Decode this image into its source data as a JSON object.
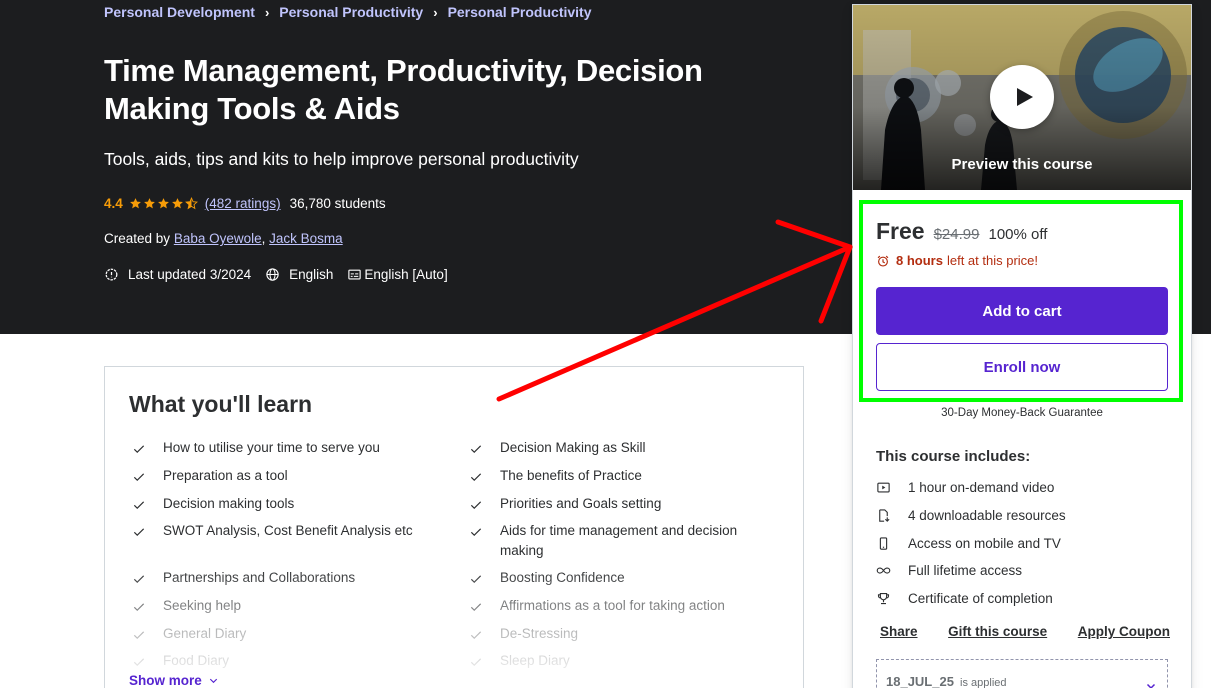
{
  "breadcrumb": [
    "Personal Development",
    "Personal Productivity",
    "Personal Productivity"
  ],
  "course": {
    "title": "Time Management, Productivity, Decision Making Tools & Aids",
    "subtitle": "Tools, aids, tips and kits to help improve personal productivity",
    "rating": "4.4",
    "rating_value": 4.4,
    "ratings_count": "(482 ratings)",
    "students": "36,780 students",
    "created_by_label": "Created by",
    "authors": [
      "Baba Oyewole",
      "Jack Bosma"
    ],
    "last_updated": "Last updated 3/2024",
    "language": "English",
    "captions": "English [Auto]"
  },
  "learn": {
    "title": "What you'll learn",
    "items": [
      "How to utilise your time to serve you",
      "Decision Making as Skill",
      "Preparation as a tool",
      "The benefits of Practice",
      "Decision making tools",
      "Priorities and Goals setting",
      "SWOT Analysis, Cost Benefit Analysis etc",
      "Aids for time management and decision making",
      "Partnerships and Collaborations",
      "Boosting Confidence",
      "Seeking help",
      "Affirmations as a tool for taking action",
      "General Diary",
      "De-Stressing",
      "Food Diary",
      "Sleep Diary"
    ],
    "show_more": "Show more"
  },
  "sidebar": {
    "preview_label": "Preview this course",
    "price": "Free",
    "original_price": "$24.99",
    "discount": "100% off",
    "timer_bold": "8 hours",
    "timer_rest": "left at this price!",
    "add_to_cart": "Add to cart",
    "enroll_now": "Enroll now",
    "guarantee": "30-Day Money-Back Guarantee",
    "includes_title": "This course includes:",
    "includes": [
      {
        "icon": "video-icon",
        "text": "1 hour on-demand video"
      },
      {
        "icon": "download-file-icon",
        "text": "4 downloadable resources"
      },
      {
        "icon": "mobile-icon",
        "text": "Access on mobile and TV"
      },
      {
        "icon": "infinity-icon",
        "text": "Full lifetime access"
      },
      {
        "icon": "trophy-icon",
        "text": "Certificate of completion"
      }
    ],
    "actions": [
      "Share",
      "Gift this course",
      "Apply Coupon"
    ],
    "coupon_code": "18_JUL_25",
    "coupon_applied": "is applied"
  },
  "colors": {
    "hero_bg": "#1c1d1f",
    "accent_purple": "#5624d0",
    "link_lavender": "#c0c4fc",
    "star_orange": "#f69c08",
    "timer_red": "#b32d0f",
    "annotation_green": "#00ff00",
    "annotation_red": "#ff0000"
  }
}
